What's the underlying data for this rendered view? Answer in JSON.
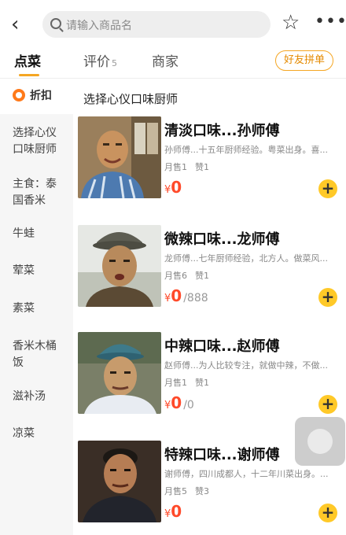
{
  "header": {
    "back_icon": "chevron-left-icon",
    "search_placeholder": "请输入商品名",
    "favorite_icon": "star-outline-icon",
    "more_icon": "more-dots-icon"
  },
  "tabs": [
    {
      "label": "点菜",
      "active": true
    },
    {
      "label": "评价",
      "count": "5"
    },
    {
      "label": "商家"
    }
  ],
  "share_button": "好友拼单",
  "sidebar": {
    "items": [
      {
        "label": "折扣",
        "icon": "discount-icon"
      },
      {
        "label": "选择心仪口味厨师"
      },
      {
        "label": "主食：泰国香米"
      },
      {
        "label": "牛蛙"
      },
      {
        "label": "荤菜"
      },
      {
        "label": "素菜"
      },
      {
        "label": "香米木桶饭"
      },
      {
        "label": "滋补汤"
      },
      {
        "label": "凉菜"
      }
    ]
  },
  "section_title": "选择心仪口味厨师",
  "items": [
    {
      "name": "清淡口味...孙师傅",
      "desc": "孙师傅...十五年厨师经验。粤菜出身。喜...",
      "sales": "月售1",
      "likes": "赞1",
      "yen": "¥",
      "price": "0",
      "orig": ""
    },
    {
      "name": "微辣口味...龙师傅",
      "desc": "龙师傅...七年厨师经验，北方人。做菜风...",
      "sales": "月售6",
      "likes": "赞1",
      "yen": "¥",
      "price": "0",
      "orig": "/888"
    },
    {
      "name": "中辣口味...赵师傅",
      "desc": "赵师傅...为人比较专注，就做中辣，不做...",
      "sales": "月售1",
      "likes": "赞1",
      "yen": "¥",
      "price": "0",
      "orig": "/0"
    },
    {
      "name": "特辣口味...谢师傅",
      "desc": "谢师傅，四川成都人，十二年川菜出身。...",
      "sales": "月售5",
      "likes": "赞3",
      "yen": "¥",
      "price": "0",
      "orig": ""
    }
  ],
  "add_button_label": "+",
  "colors": {
    "accent": "#f5a623",
    "price": "#ff4a2a",
    "add": "#ffc928"
  }
}
